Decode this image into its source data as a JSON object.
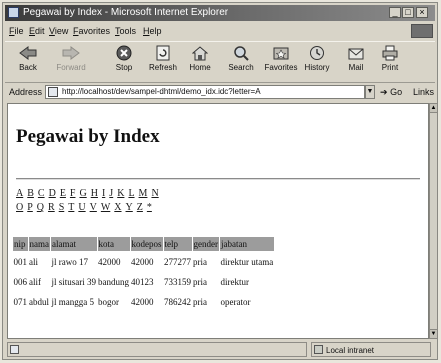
{
  "window": {
    "title": "Pegawai by Index - Microsoft Internet Explorer"
  },
  "menu": {
    "items": [
      {
        "label": "File"
      },
      {
        "label": "Edit"
      },
      {
        "label": "View"
      },
      {
        "label": "Favorites"
      },
      {
        "label": "Tools"
      },
      {
        "label": "Help"
      }
    ]
  },
  "toolbar": {
    "buttons": [
      {
        "label": "Back",
        "icon": "back-arrow-icon",
        "enabled": true
      },
      {
        "label": "Forward",
        "icon": "forward-arrow-icon",
        "enabled": false
      },
      {
        "label": "Stop",
        "icon": "stop-icon",
        "enabled": true
      },
      {
        "label": "Refresh",
        "icon": "refresh-icon",
        "enabled": true
      },
      {
        "label": "Home",
        "icon": "home-icon",
        "enabled": true
      },
      {
        "label": "Search",
        "icon": "search-icon",
        "enabled": true
      },
      {
        "label": "Favorites",
        "icon": "favorites-icon",
        "enabled": true
      },
      {
        "label": "History",
        "icon": "history-icon",
        "enabled": true
      },
      {
        "label": "Mail",
        "icon": "mail-icon",
        "enabled": true
      },
      {
        "label": "Print",
        "icon": "print-icon",
        "enabled": true
      }
    ]
  },
  "address": {
    "label": "Address",
    "url": "http://localhost/dev/sampel-dhtml/demo_idx.idc?letter=A",
    "go_label": "Go",
    "links_label": "Links"
  },
  "page": {
    "title": "Pegawai by Index",
    "letters_row1": [
      "A",
      "B",
      "C",
      "D",
      "E",
      "F",
      "G",
      "H",
      "I",
      "J",
      "K",
      "L",
      "M",
      "N"
    ],
    "letters_row2": [
      "O",
      "P",
      "Q",
      "R",
      "S",
      "T",
      "U",
      "V",
      "W",
      "X",
      "Y",
      "Z",
      "*"
    ],
    "table": {
      "headers": [
        "nip",
        "nama",
        "alamat",
        "kota",
        "kodepos",
        "telp",
        "gender",
        "jabatan"
      ],
      "rows": [
        [
          "001",
          "ali",
          "jl rawo 17",
          "42000",
          "42000",
          "277277",
          "pria",
          "direktur utama"
        ],
        [
          "006",
          "alif",
          "jl situsari 39",
          "bandung",
          "40123",
          "733159",
          "pria",
          "direktur"
        ],
        [
          "071",
          "abdul",
          "jl mangga 5",
          "bogor",
          "42000",
          "786242",
          "pria",
          "operator"
        ]
      ]
    }
  },
  "status": {
    "zone": "Local intranet"
  },
  "colors": {
    "titlebar": "#3a3a3a",
    "table_header": "#9c9c9c",
    "content_bg": "#ffffff"
  }
}
